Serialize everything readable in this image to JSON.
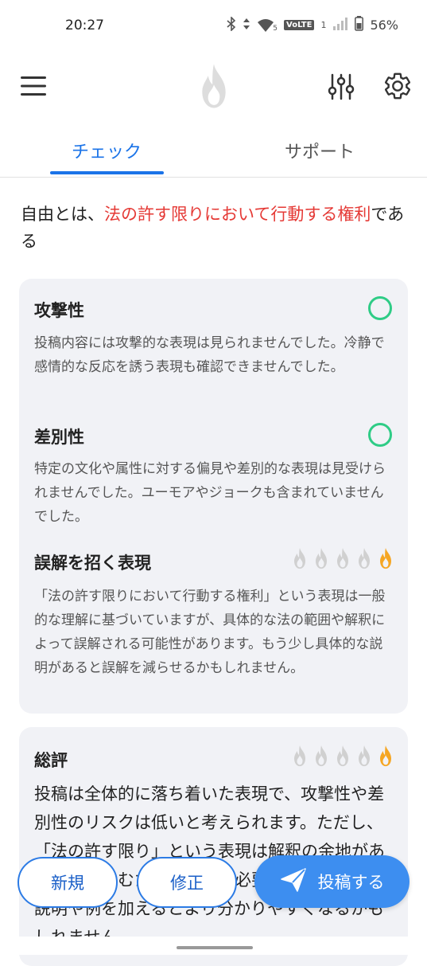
{
  "status_bar": {
    "time": "20:27",
    "network": "VoLTE",
    "sim_slot": "1",
    "wifi_badge": "5",
    "battery": "56%"
  },
  "tabs": [
    {
      "label": "チェック",
      "active": true
    },
    {
      "label": "サポート",
      "active": false
    }
  ],
  "quote": {
    "prefix": "自由とは、",
    "highlight": "法の許す限りにおいて行動する権利",
    "suffix": "である"
  },
  "colors": {
    "accent": "#1a73e8",
    "highlight": "#e53935",
    "ok": "#2fcc86",
    "flame_active": "#f5a623",
    "flame_inactive": "#d0d0d0"
  },
  "sections": [
    {
      "title": "攻撃性",
      "status": "ok",
      "body": "投稿内容には攻撃的な表現は見られませんでした。冷静で感情的な反応を誘う表現も確認できませんでした。"
    },
    {
      "title": "差別性",
      "status": "ok",
      "body": "特定の文化や属性に対する偏見や差別的な表現は見受けられませんでした。ユーモアやジョークも含まれていませんでした。"
    },
    {
      "title": "誤解を招く表現",
      "status": "flames",
      "level": 1,
      "max": 5,
      "body": "「法の許す限りにおいて行動する権利」という表現は一般的な理解に基づいていますが、具体的な法の範囲や解釈によって誤解される可能性があります。もう少し具体的な説明があると誤解を減らせるかもしれません。"
    }
  ],
  "summary": {
    "title": "総評",
    "level": 1,
    "max": 5,
    "body": "投稿は全体的に落ち着いた表現で、攻撃性や差別性のリスクは低いと考えられます。ただし、「法の許す限り」という表現は解釈の余地がある部分を含むため、注意が必要です。具体的な説明や例を加えるとより分かりやすくなるかもしれません。"
  },
  "buttons": {
    "new": "新規",
    "edit": "修正",
    "post": "投稿する"
  },
  "icons": {
    "menu": "hamburger-menu-icon",
    "logo": "flame-icon",
    "filter": "sliders-icon",
    "settings": "gear-icon",
    "post": "send-icon"
  }
}
